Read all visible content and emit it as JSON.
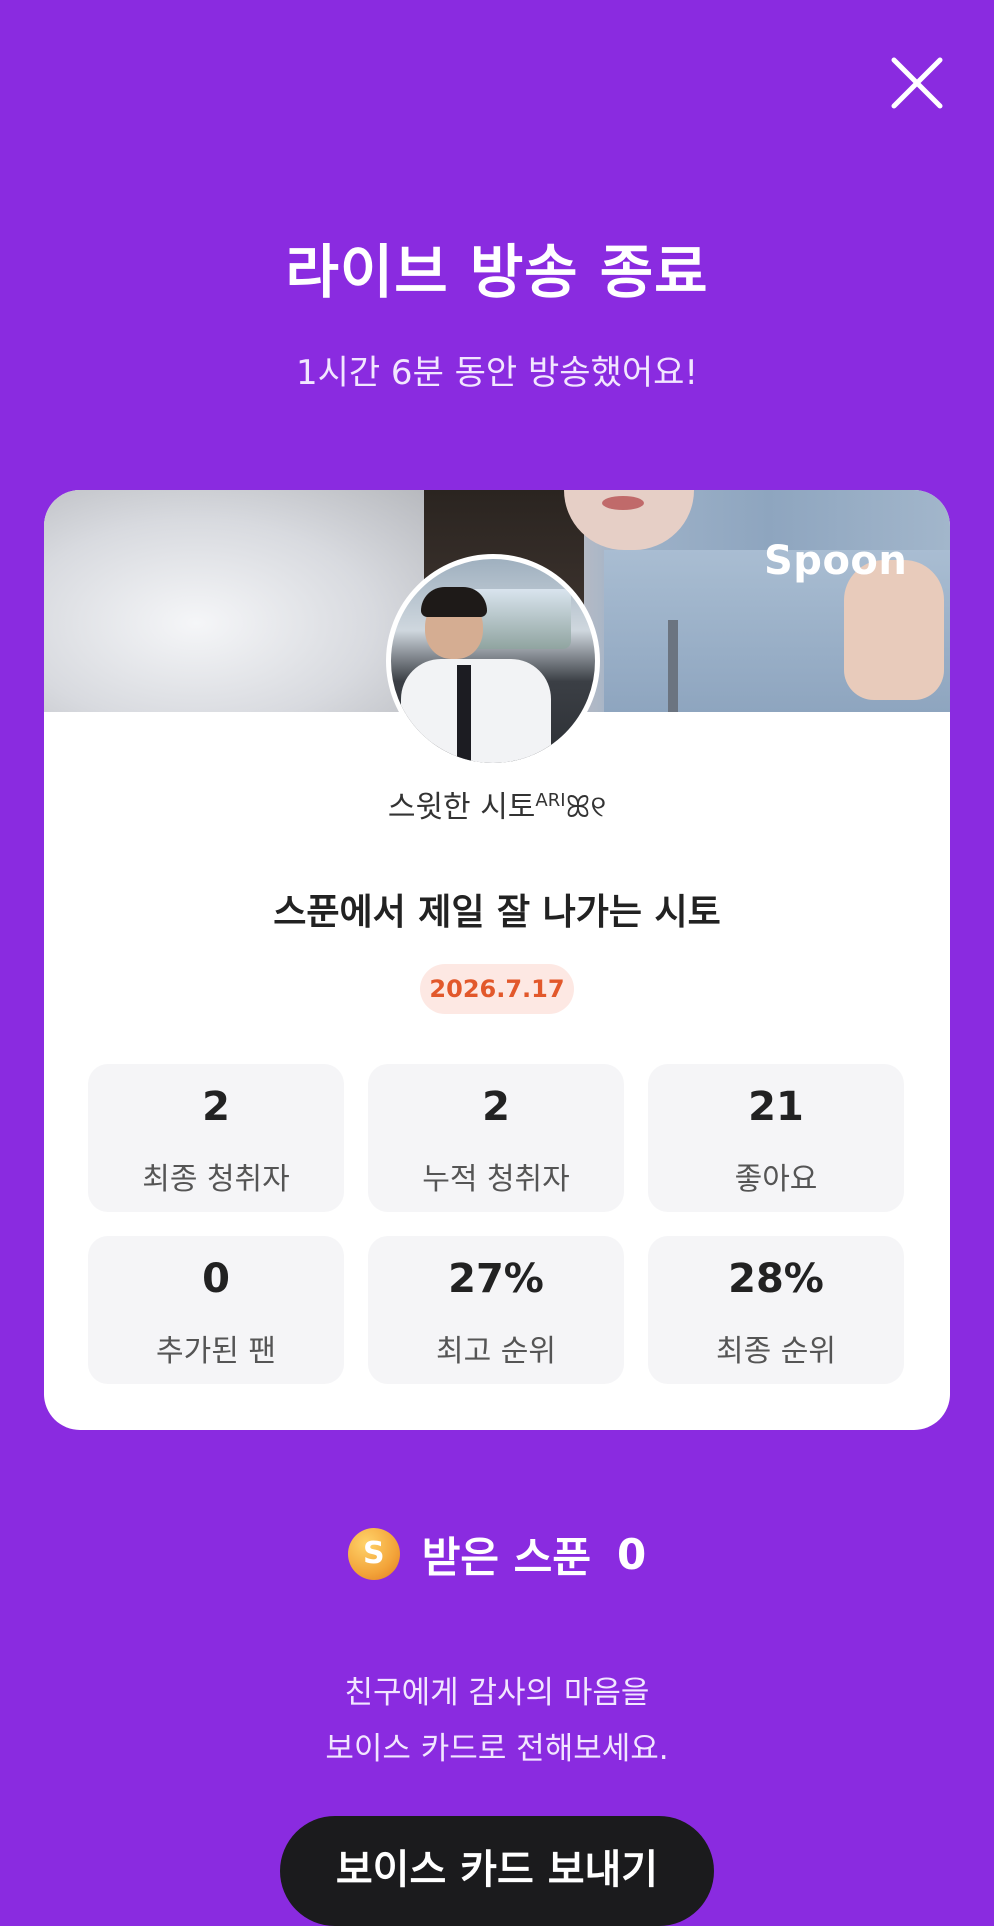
{
  "header": {
    "close_icon": "close-icon",
    "title": "라이브 방송 종료",
    "subtitle": "1시간 6분 동안 방송했어요!"
  },
  "card": {
    "brand": "Spoon",
    "nickname_main": "스윗한 시토",
    "nickname_sup": "ARI",
    "nickname_tail": "ꕤ୧",
    "live_title": "스푼에서 제일 잘 나가는 시토",
    "date": "2026.7.17",
    "stats": [
      {
        "value": "2",
        "label": "최종 청취자"
      },
      {
        "value": "2",
        "label": "누적 청취자"
      },
      {
        "value": "21",
        "label": "좋아요"
      },
      {
        "value": "0",
        "label": "추가된 팬"
      },
      {
        "value": "27%",
        "label": "최고 순위"
      },
      {
        "value": "28%",
        "label": "최종 순위"
      }
    ]
  },
  "spoons": {
    "coin_letter": "S",
    "label": "받은 스푼",
    "count": "0"
  },
  "thanks": {
    "line1": "친구에게 감사의 마음을",
    "line2": "보이스 카드로 전해보세요."
  },
  "cta": {
    "label": "보이스 카드 보내기"
  },
  "colors": {
    "background": "#8A2BE0",
    "date_badge_text": "#E2582B",
    "cta_background": "#1B1B1D"
  }
}
